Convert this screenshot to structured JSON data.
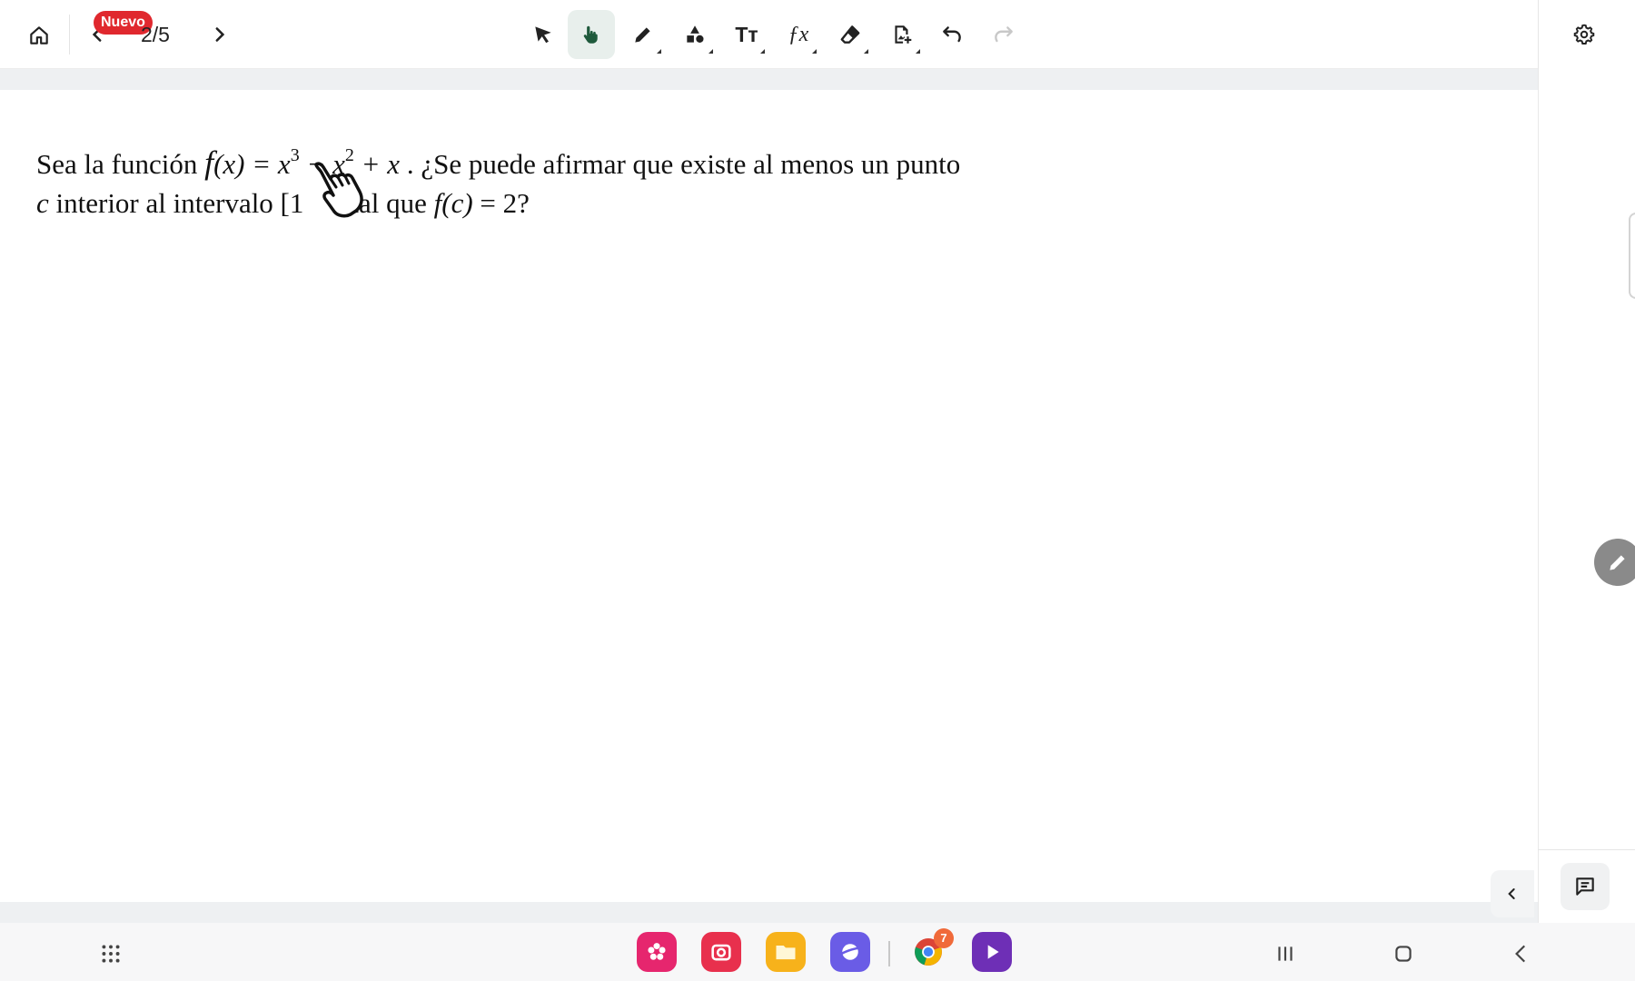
{
  "toolbar": {
    "badge_label": "Nuevo",
    "page_indicator": "2/5",
    "tools": [
      {
        "name": "select-tool",
        "icon": "pointer-arrow-icon"
      },
      {
        "name": "hand-tool",
        "icon": "hand-icon",
        "active": true
      },
      {
        "name": "pen-tool",
        "icon": "pencil-icon"
      },
      {
        "name": "shapes-tool",
        "icon": "shapes-icon"
      },
      {
        "name": "text-tool",
        "icon": "text-icon"
      },
      {
        "name": "formula-tool",
        "icon": "function-icon"
      },
      {
        "name": "eraser-tool",
        "icon": "eraser-icon"
      },
      {
        "name": "add-image-tool",
        "icon": "image-add-icon"
      },
      {
        "name": "undo",
        "icon": "undo-icon"
      },
      {
        "name": "redo",
        "icon": "redo-icon",
        "disabled": true
      }
    ],
    "tools_text": {
      "text_tool_glyph": "Tт",
      "formula_tool_glyph": "ƒx"
    },
    "accent_color": "#1f5a3c"
  },
  "problem": {
    "line1_prefix": "Sea la función ",
    "fn_name": "f",
    "fn_args": "(x) = x",
    "exp3": "3",
    "minus_x": " − x",
    "exp2": "2",
    "plus_x": " + x",
    "line1_suffix": " . ¿Se puede afirmar que existe al menos un punto",
    "line2_c": "c",
    "line2_a": " interior al intervalo [1",
    "line2_b": "tal que ",
    "line2_fc": "f(c)",
    "line2_end": " = 2?"
  },
  "dock": {
    "apps": [
      "blossom-app-icon",
      "camera-app-icon",
      "files-app-icon",
      "browser-app-icon",
      "chrome-icon",
      "play-app-icon"
    ],
    "chrome_badge": "7",
    "colors": {
      "blossom": "#e6266e",
      "camera": "#e8304d",
      "files": "#f7b21b",
      "browser": "#6a5ce6",
      "play": "#6e2fb6"
    }
  }
}
